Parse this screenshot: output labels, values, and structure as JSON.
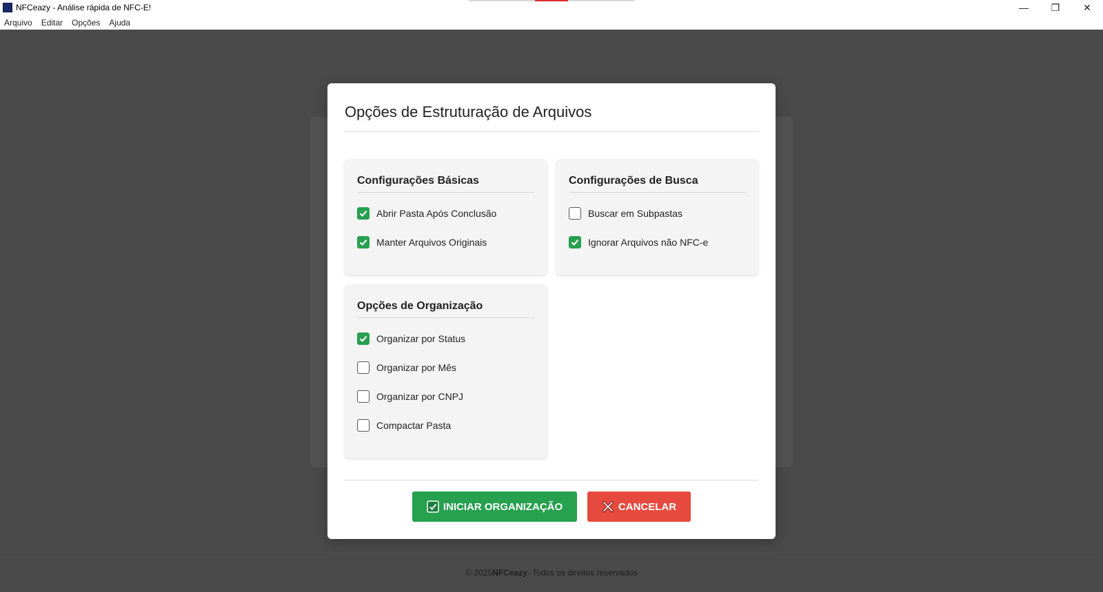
{
  "window": {
    "title": "NFCeazy - Análise rápida de NFC-E!",
    "controls": {
      "minimize": "—",
      "maximize": "❐",
      "close": "✕"
    }
  },
  "menu": {
    "items": [
      "Arquivo",
      "Editar",
      "Opções",
      "Ajuda"
    ]
  },
  "modal": {
    "title": "Opções de Estruturação de Arquivos",
    "sections": {
      "basic": {
        "title": "Configurações Básicas",
        "options": [
          {
            "label": "Abrir Pasta Após Conclusão",
            "checked": true
          },
          {
            "label": "Manter Arquivos Originais",
            "checked": true
          }
        ]
      },
      "search": {
        "title": "Configurações de Busca",
        "options": [
          {
            "label": "Buscar em Subpastas",
            "checked": false
          },
          {
            "label": "Ignorar Arquivos não NFC-e",
            "checked": true
          }
        ]
      },
      "organization": {
        "title": "Opções de Organização",
        "options": [
          {
            "label": "Organizar por Status",
            "checked": true
          },
          {
            "label": "Organizar por Mês",
            "checked": false
          },
          {
            "label": "Organizar por CNPJ",
            "checked": false
          },
          {
            "label": "Compactar Pasta",
            "checked": false
          }
        ]
      }
    },
    "buttons": {
      "start": "INICIAR ORGANIZAÇÃO",
      "cancel": "CANCELAR"
    }
  },
  "footer": {
    "prefix": "© 2025 ",
    "brand": "NFCeazy",
    "suffix": " - Todos os direitos reservados"
  },
  "colors": {
    "accent_green": "#27a04f",
    "cancel_red": "#e64a3e",
    "backdrop": "#4a4a4a"
  }
}
